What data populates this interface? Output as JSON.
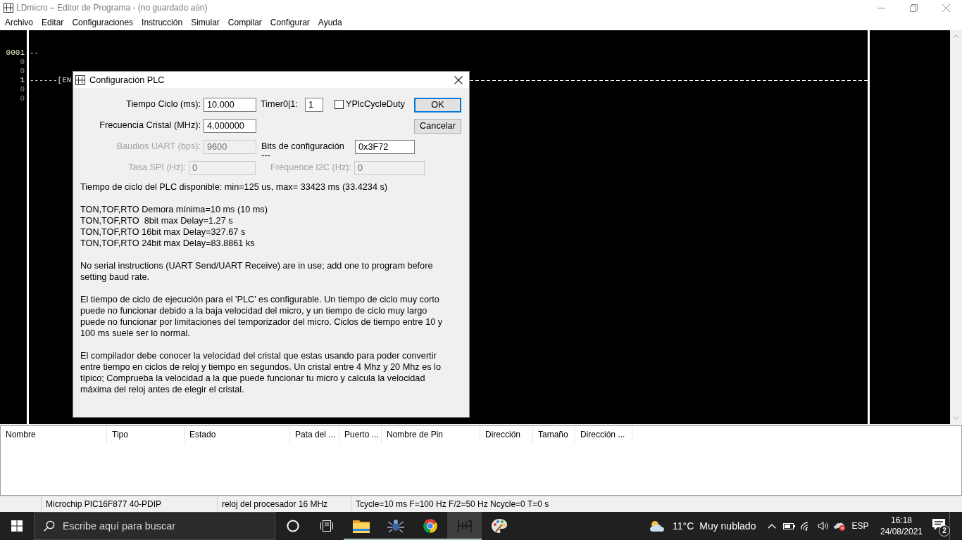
{
  "window": {
    "title": "LDmicro – Editor de Programa - (no guardado aún)"
  },
  "menu": [
    "Archivo",
    "Editar",
    "Configuraciones",
    "Instrucción",
    "Simular",
    "Compilar",
    "Configurar",
    "Ayuda"
  ],
  "ladder": {
    "rows": [
      {
        "number": "0001",
        "kind": "rung",
        "lit": true,
        "wire": {
          "text": "--",
          "kind": "stub"
        }
      },
      {
        "number": "0",
        "kind": "bit",
        "lit": false
      },
      {
        "number": "0",
        "kind": "bit",
        "lit": false
      },
      {
        "number": "1",
        "kind": "bit",
        "lit": true,
        "wire": {
          "text": "------[EN",
          "kind": "rung"
        }
      },
      {
        "number": "0",
        "kind": "bit",
        "lit": false
      },
      {
        "number": "0",
        "kind": "bit",
        "lit": false
      }
    ]
  },
  "dialog": {
    "title": "Configuración PLC",
    "rows": [
      [
        {
          "kind": "field",
          "label": "Tiempo Ciclo (ms):",
          "value": "10.000",
          "disabled": false
        },
        {
          "kind": "field",
          "label": "Timer0|1:",
          "value": "1",
          "disabled": false
        },
        {
          "kind": "checkbox",
          "label": "YPlcCycleDuty",
          "checked": false
        }
      ],
      [
        {
          "kind": "field",
          "label": "Frecuencia Cristal (MHz):",
          "value": "4.000000",
          "disabled": false
        }
      ],
      [
        {
          "kind": "field",
          "label": "Baudios UART (bps):",
          "value": "9600",
          "disabled": true
        },
        {
          "kind": "field",
          "label": "Bits de configuración\n---",
          "value": "0x3F72",
          "disabled": false
        }
      ],
      [
        {
          "kind": "field",
          "label": "Tasa SPI (Hz):",
          "value": "0",
          "disabled": true
        },
        {
          "kind": "field",
          "label": "Fréquence I2C (Hz):",
          "value": "0",
          "disabled": true
        }
      ]
    ],
    "buttons": [
      {
        "label": "OK",
        "default": true
      },
      {
        "label": "Cancelar",
        "default": false
      }
    ],
    "info": [
      [
        "Tiempo de ciclo del PLC disponible: min=125 us, max= 33423 ms (33.4234 s)"
      ],
      [
        "TON,TOF,RTO Demora mínima=10 ms (10 ms)",
        "TON,TOF,RTO  8bit max Delay=1.27 s",
        "TON,TOF,RTO 16bit max Delay=327.67 s",
        "TON,TOF,RTO 24bit max Delay=83.8861 ks"
      ],
      [
        "No serial instructions (UART Send/UART Receive) are in use; add one to program before setting baud rate."
      ],
      [
        "El tiempo de ciclo de ejecución para el 'PLC' es configurable. Un tiempo de ciclo muy corto puede no funcionar debido a la baja velocidad del micro, y un tiempo de ciclo muy largo puede no funcionar por limitaciones del temporizador del micro. Ciclos de tiempo entre 10 y 100 ms suele ser lo normal."
      ],
      [
        "El compilador debe conocer la velocidad del cristal que estas usando para poder convertir entre tiempo en ciclos de reloj y tiempo en segundos. Un cristal entre 4 Mhz y 20 Mhz es lo típico; Comprueba la velocidad a la que puede funcionar tu micro y calcula la velocidad máxima del reloj antes de elegir el cristal."
      ]
    ]
  },
  "table": {
    "columns": [
      "Nombre",
      "Tipo",
      "Estado",
      "Pata del ...",
      "Puerto ...",
      "Nombre de Pin",
      "Dirección",
      "Tamaño",
      "Dirección ..."
    ]
  },
  "status_bar": {
    "sections": [
      "Microchip PIC16F877 40-PDIP",
      "reloj del procesador 16 MHz",
      "Tcycle=10 ms F=100 Hz F/2=50 Hz Ncycle=0 T=0 s"
    ]
  },
  "taskbar": {
    "search": {
      "placeholder": "Escribe aquí para buscar"
    },
    "apps": [
      {
        "kind": "folder",
        "selected": false,
        "running": true
      },
      {
        "kind": "bug",
        "selected": false,
        "running": true
      },
      {
        "kind": "browser",
        "selected": false,
        "running": true
      },
      {
        "kind": "ladder",
        "selected": true,
        "running": true
      },
      {
        "kind": "palette",
        "selected": false,
        "running": false
      }
    ],
    "weather": {
      "temperature": "11°C",
      "condition": "Muy nublado"
    },
    "language": "ESP",
    "time": "16:18",
    "date": "24/08/2021",
    "notifications": "2"
  }
}
